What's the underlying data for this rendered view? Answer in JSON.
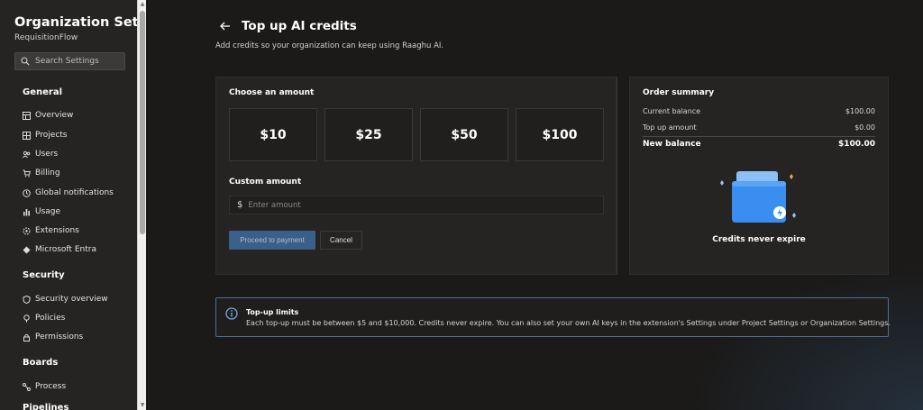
{
  "sidebar": {
    "org_title": "Organization Settin...",
    "org_subtitle": "RequisitionFlow",
    "search_placeholder": "Search Settings",
    "sections": {
      "general": "General",
      "security": "Security",
      "boards": "Boards",
      "pipelines": "Pipelines"
    },
    "general_items": [
      "Overview",
      "Projects",
      "Users",
      "Billing",
      "Global notifications",
      "Usage",
      "Extensions",
      "Microsoft Entra"
    ],
    "security_items": [
      "Security overview",
      "Policies",
      "Permissions"
    ],
    "boards_items": [
      "Process"
    ]
  },
  "header": {
    "title": "Top up AI credits",
    "description": "Add credits so your organization can keep using Raaghu AI."
  },
  "amount": {
    "heading": "Choose an amount",
    "options": [
      "$10",
      "$25",
      "$50",
      "$100"
    ],
    "custom_label": "Custom amount",
    "currency_symbol": "$",
    "custom_placeholder": "Enter amount",
    "proceed_label": "Proceed to payment",
    "cancel_label": "Cancel"
  },
  "summary": {
    "heading": "Order summary",
    "current_balance_label": "Current balance",
    "current_balance_value": "$100.00",
    "top_up_label": "Top up amount",
    "top_up_value": "$0.00",
    "new_balance_label": "New balance",
    "new_balance_value": "$100.00",
    "caption": "Credits never expire"
  },
  "limits": {
    "title": "Top-up limits",
    "text": "Each top-up must be between $5 and $10,000. Credits never expire. You can also set your own AI keys in the extension's Settings under Project Settings or Organization Settings."
  },
  "colors": {
    "accent": "#3a5f88",
    "info_border": "#4c6f94",
    "wallet_blue": "#3a8ef0"
  }
}
